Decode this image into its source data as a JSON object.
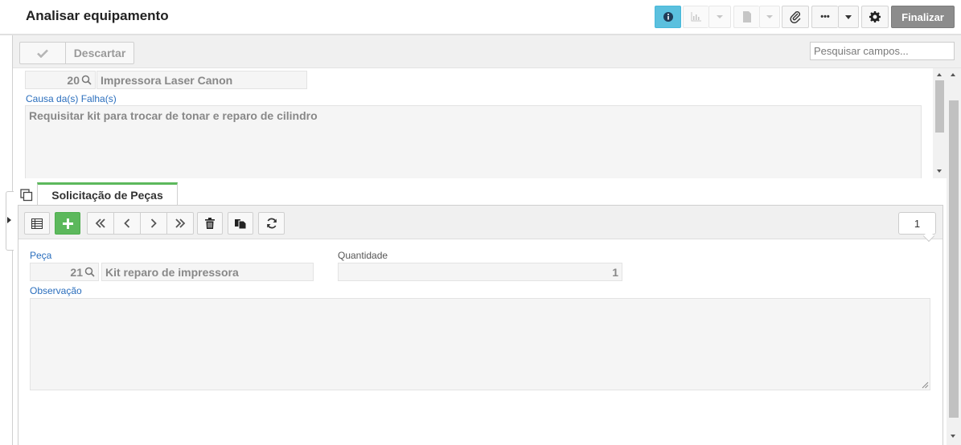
{
  "header": {
    "title": "Analisar equipamento",
    "finalize_label": "Finalizar",
    "more_label": "•••"
  },
  "actions": {
    "discard_label": "Descartar",
    "search_placeholder": "Pesquisar campos..."
  },
  "equipment": {
    "code": "20",
    "name": "Impressora Laser Canon"
  },
  "failure_cause": {
    "label": "Causa da(s) Falha(s)",
    "value": "Requisitar kit para trocar de tonar e reparo de cilindro"
  },
  "tabs": [
    {
      "label": "Solicitação de Peças",
      "active": true
    }
  ],
  "grid": {
    "record_count": "1",
    "part": {
      "label": "Peça",
      "code": "21",
      "name": "Kit reparo de impressora"
    },
    "quantity": {
      "label": "Quantidade",
      "value": "1"
    },
    "notes": {
      "label": "Observação",
      "value": ""
    }
  },
  "colors": {
    "accent_info": "#5bc0de",
    "add_green": "#5cb85c",
    "label_blue": "#2a6ebd",
    "finalize_gray": "#8c8c8c"
  }
}
